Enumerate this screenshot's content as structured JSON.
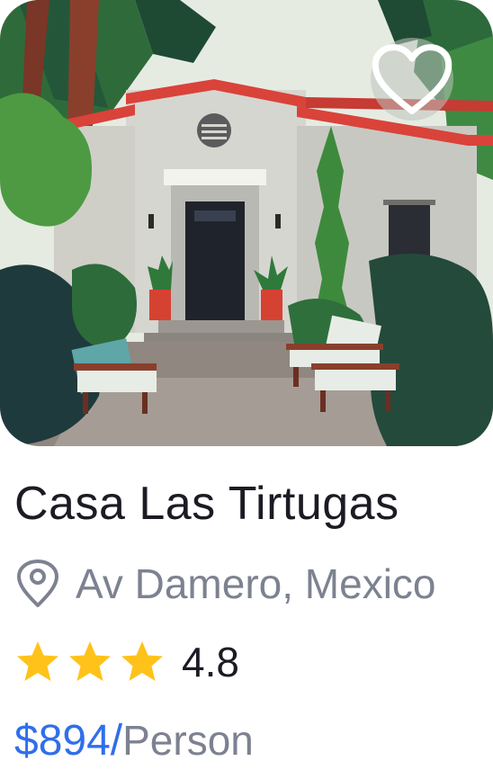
{
  "listing": {
    "title": "Casa Las Tirtugas",
    "location": "Av Damero, Mexico",
    "rating": "4.8",
    "stars_shown": 3,
    "price": "$894",
    "price_separator": "/",
    "price_unit": "Person",
    "favorite_icon": "heart-outline-icon",
    "location_icon": "map-pin-icon",
    "star_icon": "star-icon"
  },
  "colors": {
    "accent": "#2f6fe9",
    "title": "#1b1b24",
    "secondary_text": "#7d8291",
    "star": "#ffc21a",
    "roof": "#d9433a"
  }
}
